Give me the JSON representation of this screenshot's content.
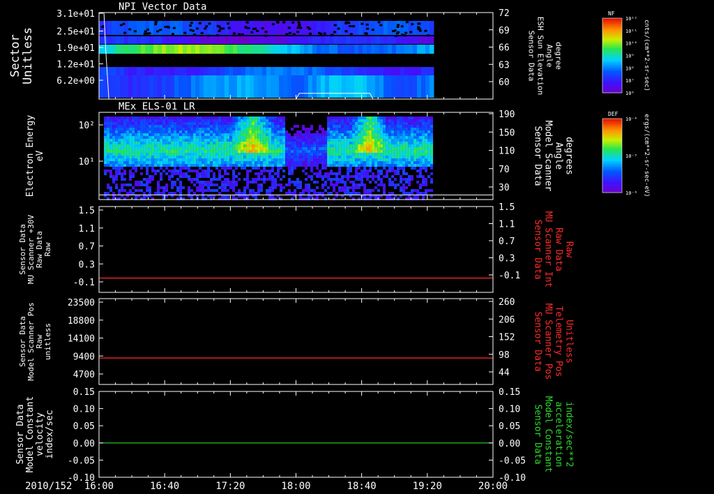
{
  "date_label": "2010/152",
  "x_ticks": [
    "16:00",
    "16:40",
    "17:20",
    "18:00",
    "18:40",
    "19:20",
    "20:00"
  ],
  "panels": [
    {
      "id": "npi",
      "title": "NPI Vector Data",
      "left_label": [
        "Sector",
        "Unitless"
      ],
      "left_color": "#ffffff",
      "left_ticks": [
        "3.1e+01",
        "2.5e+01",
        "1.9e+01",
        "1.2e+01",
        "6.2e+00"
      ],
      "right_label": [
        "Sensor Data",
        "ESH Sun Elevation",
        "Angle",
        "degree"
      ],
      "right_color": "#ffffff",
      "right_ticks": [
        "72",
        "69",
        "66",
        "63",
        "60"
      ]
    },
    {
      "id": "els",
      "title": "MEx ELS-01 LR",
      "left_label": [
        "Electron Energy",
        "eV"
      ],
      "left_color": "#ffffff",
      "left_ticks": [
        "10²",
        "10¹"
      ],
      "right_label": [
        "Sensor Data",
        "Model Scanner",
        "Angle",
        "degrees"
      ],
      "right_color": "#ffffff",
      "right_ticks": [
        "190",
        "150",
        "110",
        "70",
        "30"
      ]
    },
    {
      "id": "mu30v",
      "title": "",
      "left_label": [
        "Sensor Data",
        "MU Scanner +30V",
        "Raw Data",
        "Raw"
      ],
      "left_color": "#ffffff",
      "left_ticks": [
        "1.5",
        "1.1",
        "0.7",
        "0.3",
        "-0.1"
      ],
      "right_label": [
        "Sensor Data",
        "MU Scanner Int",
        "Raw Data",
        "Raw"
      ],
      "right_color": "#ff2a2a",
      "right_ticks": [
        "1.5",
        "1.1",
        "0.7",
        "0.3",
        "-0.1"
      ]
    },
    {
      "id": "scanpos",
      "title": "",
      "left_label": [
        "Sensor Data",
        "Model Scanner Pos",
        "Raw",
        "unitless"
      ],
      "left_color": "#ffffff",
      "left_ticks": [
        "23500",
        "18800",
        "14100",
        "9400",
        "4700"
      ],
      "right_label": [
        "Sensor Data",
        "MU Scanner Pos",
        "Telemetry Pos",
        "Unitless"
      ],
      "right_color": "#ff2a2a",
      "right_ticks": [
        "260",
        "206",
        "152",
        "98",
        "44"
      ]
    },
    {
      "id": "constvel",
      "title": "",
      "left_label": [
        "Sensor Data",
        "Model Constant",
        "velocity",
        "index/sec"
      ],
      "left_color": "#ffffff",
      "left_ticks": [
        "0.15",
        "0.10",
        "0.05",
        "0.00",
        "-0.05",
        "-0.10"
      ],
      "right_label": [
        "Sensor Data",
        "Model Constant",
        "acceleration",
        "index/sec**2"
      ],
      "right_color": "#2bdc2b",
      "right_ticks": [
        "0.15",
        "0.10",
        "0.05",
        "0.00",
        "-0.05",
        "-0.10"
      ]
    }
  ],
  "colorbars": [
    {
      "tag": "NF",
      "unit": "cnts/(cm**2-sr-sec)",
      "ticks": [
        "10¹²",
        "10¹¹",
        "10¹⁰",
        "10⁹",
        "10⁸",
        "10⁷",
        "10⁶"
      ]
    },
    {
      "tag": "DEF",
      "unit": "ergs/(cm**2-sr-sec-eV)",
      "ticks": [
        "10⁻⁴",
        "10⁻⁵",
        "10⁻⁶"
      ]
    }
  ],
  "chart_data": [
    {
      "type": "heatmap",
      "title": "NPI Vector Data",
      "ylabel": "Sector Unitless",
      "y2label": "Sensor Data ESH Sun Elevation Angle degree",
      "ylim": [
        0,
        31
      ],
      "y2lim": [
        57,
        72
      ],
      "colorbar": "NF",
      "data_end_time": "19:22",
      "overlay_line": {
        "name": "ESH Sun Elevation Angle",
        "x": [
          "16:00",
          "16:03",
          "16:04",
          "16:06",
          "16:10",
          "18:00",
          "18:02",
          "18:45",
          "18:47",
          "19:22"
        ],
        "y": [
          72,
          72,
          66,
          57,
          57,
          57,
          58,
          58,
          57,
          57
        ]
      }
    },
    {
      "type": "heatmap",
      "title": "MEx ELS-01 LR",
      "ylabel": "Electron Energy eV",
      "y2label": "Sensor Data Model Scanner Angle degrees",
      "yscale": "log",
      "y2lim": [
        0,
        190
      ],
      "colorbar": "DEF",
      "data_start_time": "16:03",
      "data_end_time": "19:22",
      "overlay_line": {
        "name": "Model Scanner Angle",
        "x": [
          "16:00",
          "20:00"
        ],
        "y": [
          10,
          10
        ]
      }
    },
    {
      "type": "line",
      "ylim": [
        -0.3,
        1.5
      ],
      "series": [
        {
          "name": "MU Scanner Int Raw Data",
          "x": [
            "16:00",
            "20:00"
          ],
          "y": [
            0,
            0
          ],
          "color": "#ff2a2a"
        }
      ]
    },
    {
      "type": "line",
      "ylim": [
        0,
        23500
      ],
      "y2lim": [
        0,
        260
      ],
      "series": [
        {
          "name": "MU Scanner Pos Telemetry Pos",
          "x": [
            "16:00",
            "20:00"
          ],
          "y": [
            80,
            80
          ],
          "color": "#ff2a2a"
        }
      ]
    },
    {
      "type": "line",
      "ylim": [
        -0.1,
        0.15
      ],
      "series": [
        {
          "name": "Model Constant acceleration",
          "x": [
            "16:00",
            "20:00"
          ],
          "y": [
            0,
            0
          ],
          "color": "#2bdc2b"
        }
      ]
    }
  ]
}
